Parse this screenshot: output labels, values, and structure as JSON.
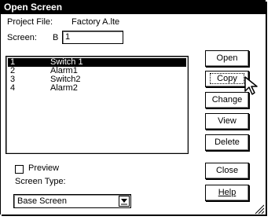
{
  "dialog": {
    "title": "Open Screen"
  },
  "project": {
    "label": "Project File:",
    "value": "Factory A.lte"
  },
  "screen": {
    "label": "Screen:",
    "prefix": "B",
    "value": "1"
  },
  "list": {
    "items": [
      {
        "num": "1",
        "name": "Switch 1",
        "selected": true
      },
      {
        "num": "2",
        "name": "Alarm1",
        "selected": false
      },
      {
        "num": "3",
        "name": "Switch2",
        "selected": false
      },
      {
        "num": "4",
        "name": "Alarm2",
        "selected": false
      }
    ]
  },
  "buttons": {
    "open": "Open",
    "copy": "Copy",
    "change": "Change",
    "view": "View",
    "delete": "Delete",
    "close": "Close",
    "help": "Help"
  },
  "preview": {
    "label": "Preview",
    "checked": false
  },
  "screen_type": {
    "label": "Screen Type:",
    "value": "Base Screen"
  },
  "icons": {
    "cursor": "mouse-pointer-icon",
    "dropdown": "chevron-down-icon",
    "resize": "resize-grip-icon"
  },
  "colors": {
    "titlebar": "#000000",
    "selection": "#000000",
    "background": "#ffffff"
  }
}
